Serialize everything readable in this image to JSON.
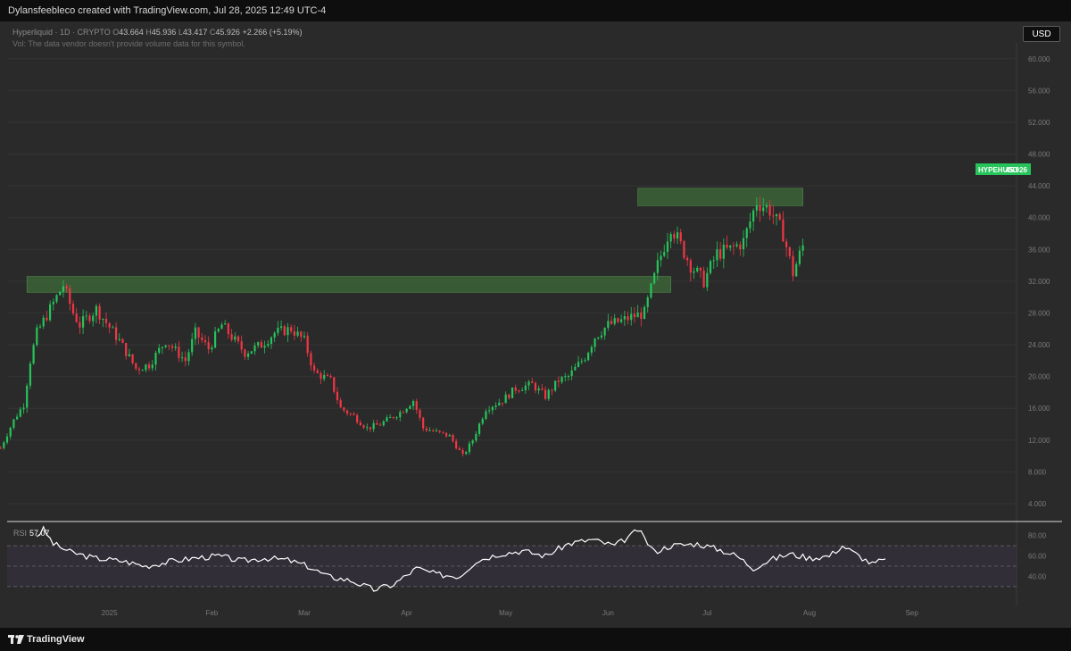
{
  "header": {
    "attribution": "Dylansfeebleco created with TradingView.com, Jul 28, 2025 12:49 UTC-4"
  },
  "symbol_info": {
    "name": "Hyperliquid · 1D · CRYPTO",
    "o_label": "O",
    "o_value": "43.664",
    "h_label": "H",
    "h_value": "45.936",
    "l_label": "L",
    "l_value": "43.417",
    "c_label": "C",
    "c_value": "45.926",
    "change": "+2.266 (+5.19%)",
    "volume_note": "Vol: The data vendor doesn't provide volume data for this symbol."
  },
  "currency_button": "USD",
  "price_badge": {
    "symbol": "HYPEHUSD",
    "value": "45.926"
  },
  "footer": {
    "brand": "TradingView"
  },
  "colors": {
    "up": "#22ab94",
    "up_bright": "#26c45a",
    "down": "#f23645",
    "zone": "#3d6b3a",
    "rsi_line": "#ffffff",
    "rsi_band": "#3a3448"
  },
  "chart_data": [
    {
      "type": "candlestick",
      "title": "Hyperliquid · 1D · CRYPTO",
      "y_ticks": [
        "60.000",
        "56.000",
        "52.000",
        "48.000",
        "44.000",
        "40.000",
        "36.000",
        "32.000",
        "28.000",
        "24.000",
        "20.000",
        "16.000",
        "12.000",
        "8.000",
        "4.000"
      ],
      "x_ticks": [
        "2025",
        "Feb",
        "Mar",
        "Apr",
        "May",
        "Jun",
        "Jul",
        "Aug",
        "Sep"
      ],
      "ylim": [
        2.2,
        62
      ],
      "x_range": [
        "2024-12-01",
        "2025-09-30"
      ],
      "grid": true,
      "last_close": 45.926,
      "zones": [
        {
          "x_start": "2024-12-07",
          "x_end": "2025-06-20",
          "y_low": 30.6,
          "y_high": 32.6
        },
        {
          "x_start": "2025-06-10",
          "x_end": "2025-07-30",
          "y_low": 41.5,
          "y_high": 43.7
        }
      ],
      "anchors": [
        {
          "date": "2024-11-29",
          "price": 11.0
        },
        {
          "date": "2024-12-03",
          "price": 14.5
        },
        {
          "date": "2024-12-06",
          "price": 16.5
        },
        {
          "date": "2024-12-08",
          "price": 22.0
        },
        {
          "date": "2024-12-10",
          "price": 25.5
        },
        {
          "date": "2024-12-14",
          "price": 28.5
        },
        {
          "date": "2024-12-18",
          "price": 31.5
        },
        {
          "date": "2024-12-21",
          "price": 28.0
        },
        {
          "date": "2024-12-23",
          "price": 26.5
        },
        {
          "date": "2024-12-28",
          "price": 28.5
        },
        {
          "date": "2025-01-04",
          "price": 24.5
        },
        {
          "date": "2025-01-09",
          "price": 21.0
        },
        {
          "date": "2025-01-13",
          "price": 21.5
        },
        {
          "date": "2025-01-18",
          "price": 24.5
        },
        {
          "date": "2025-01-24",
          "price": 22.0
        },
        {
          "date": "2025-01-27",
          "price": 25.5
        },
        {
          "date": "2025-01-31",
          "price": 23.5
        },
        {
          "date": "2025-02-04",
          "price": 26.5
        },
        {
          "date": "2025-02-07",
          "price": 25.0
        },
        {
          "date": "2025-02-11",
          "price": 23.0
        },
        {
          "date": "2025-02-16",
          "price": 24.0
        },
        {
          "date": "2025-02-20",
          "price": 25.5
        },
        {
          "date": "2025-02-25",
          "price": 26.0
        },
        {
          "date": "2025-03-01",
          "price": 24.5
        },
        {
          "date": "2025-03-04",
          "price": 20.5
        },
        {
          "date": "2025-03-09",
          "price": 19.5
        },
        {
          "date": "2025-03-12",
          "price": 16.0
        },
        {
          "date": "2025-03-16",
          "price": 15.0
        },
        {
          "date": "2025-03-20",
          "price": 13.5
        },
        {
          "date": "2025-03-24",
          "price": 14.0
        },
        {
          "date": "2025-03-30",
          "price": 15.5
        },
        {
          "date": "2025-04-03",
          "price": 17.0
        },
        {
          "date": "2025-04-06",
          "price": 13.5
        },
        {
          "date": "2025-04-10",
          "price": 13.0
        },
        {
          "date": "2025-04-14",
          "price": 12.5
        },
        {
          "date": "2025-04-18",
          "price": 10.0
        },
        {
          "date": "2025-04-21",
          "price": 12.0
        },
        {
          "date": "2025-04-25",
          "price": 16.0
        },
        {
          "date": "2025-04-30",
          "price": 17.0
        },
        {
          "date": "2025-05-04",
          "price": 18.5
        },
        {
          "date": "2025-05-09",
          "price": 19.0
        },
        {
          "date": "2025-05-13",
          "price": 17.5
        },
        {
          "date": "2025-05-17",
          "price": 19.5
        },
        {
          "date": "2025-05-20",
          "price": 20.0
        },
        {
          "date": "2025-05-25",
          "price": 22.5
        },
        {
          "date": "2025-05-28",
          "price": 25.0
        },
        {
          "date": "2025-06-01",
          "price": 26.5
        },
        {
          "date": "2025-06-05",
          "price": 27.0
        },
        {
          "date": "2025-06-08",
          "price": 27.5
        },
        {
          "date": "2025-06-12",
          "price": 28.0
        },
        {
          "date": "2025-06-16",
          "price": 34.0
        },
        {
          "date": "2025-06-20",
          "price": 39.0
        },
        {
          "date": "2025-06-26",
          "price": 34.0
        },
        {
          "date": "2025-06-30",
          "price": 32.0
        },
        {
          "date": "2025-07-04",
          "price": 35.5
        },
        {
          "date": "2025-07-08",
          "price": 36.0
        },
        {
          "date": "2025-07-12",
          "price": 37.0
        },
        {
          "date": "2025-07-16",
          "price": 42.0
        },
        {
          "date": "2025-07-20",
          "price": 41.0
        },
        {
          "date": "2025-07-24",
          "price": 38.0
        },
        {
          "date": "2025-07-27",
          "price": 33.0
        },
        {
          "date": "2025-07-30",
          "price": 36.5
        }
      ]
    },
    {
      "type": "line",
      "title": "RSI",
      "name": "RSI",
      "last_value": "57.07",
      "y_ticks": [
        "80.00",
        "60.00",
        "40.00"
      ],
      "bands": [
        70,
        30
      ],
      "ylim": [
        15,
        92
      ],
      "anchors": [
        {
          "date": "2024-12-10",
          "value": 80
        },
        {
          "date": "2024-12-12",
          "value": 86
        },
        {
          "date": "2024-12-15",
          "value": 72
        },
        {
          "date": "2024-12-20",
          "value": 64
        },
        {
          "date": "2024-12-27",
          "value": 58
        },
        {
          "date": "2025-01-05",
          "value": 55
        },
        {
          "date": "2025-01-12",
          "value": 50
        },
        {
          "date": "2025-01-20",
          "value": 55
        },
        {
          "date": "2025-01-27",
          "value": 58
        },
        {
          "date": "2025-02-03",
          "value": 60
        },
        {
          "date": "2025-02-10",
          "value": 55
        },
        {
          "date": "2025-02-17",
          "value": 58
        },
        {
          "date": "2025-02-24",
          "value": 56
        },
        {
          "date": "2025-03-02",
          "value": 50
        },
        {
          "date": "2025-03-08",
          "value": 40
        },
        {
          "date": "2025-03-15",
          "value": 36
        },
        {
          "date": "2025-03-22",
          "value": 27
        },
        {
          "date": "2025-03-28",
          "value": 32
        },
        {
          "date": "2025-04-04",
          "value": 48
        },
        {
          "date": "2025-04-10",
          "value": 42
        },
        {
          "date": "2025-04-17",
          "value": 40
        },
        {
          "date": "2025-04-22",
          "value": 55
        },
        {
          "date": "2025-04-29",
          "value": 62
        },
        {
          "date": "2025-05-06",
          "value": 65
        },
        {
          "date": "2025-05-13",
          "value": 60
        },
        {
          "date": "2025-05-20",
          "value": 72
        },
        {
          "date": "2025-05-27",
          "value": 76
        },
        {
          "date": "2025-06-03",
          "value": 70
        },
        {
          "date": "2025-06-08",
          "value": 80
        },
        {
          "date": "2025-06-10",
          "value": 86
        },
        {
          "date": "2025-06-15",
          "value": 64
        },
        {
          "date": "2025-06-20",
          "value": 70
        },
        {
          "date": "2025-06-28",
          "value": 72
        },
        {
          "date": "2025-07-05",
          "value": 66
        },
        {
          "date": "2025-07-10",
          "value": 60
        },
        {
          "date": "2025-07-15",
          "value": 48
        },
        {
          "date": "2025-07-20",
          "value": 56
        },
        {
          "date": "2025-07-26",
          "value": 62
        },
        {
          "date": "2025-08-01",
          "value": 58
        },
        {
          "date": "2025-08-07",
          "value": 60
        },
        {
          "date": "2025-08-11",
          "value": 70
        },
        {
          "date": "2025-08-16",
          "value": 60
        },
        {
          "date": "2025-08-20",
          "value": 52
        },
        {
          "date": "2025-08-24",
          "value": 57
        }
      ]
    }
  ]
}
